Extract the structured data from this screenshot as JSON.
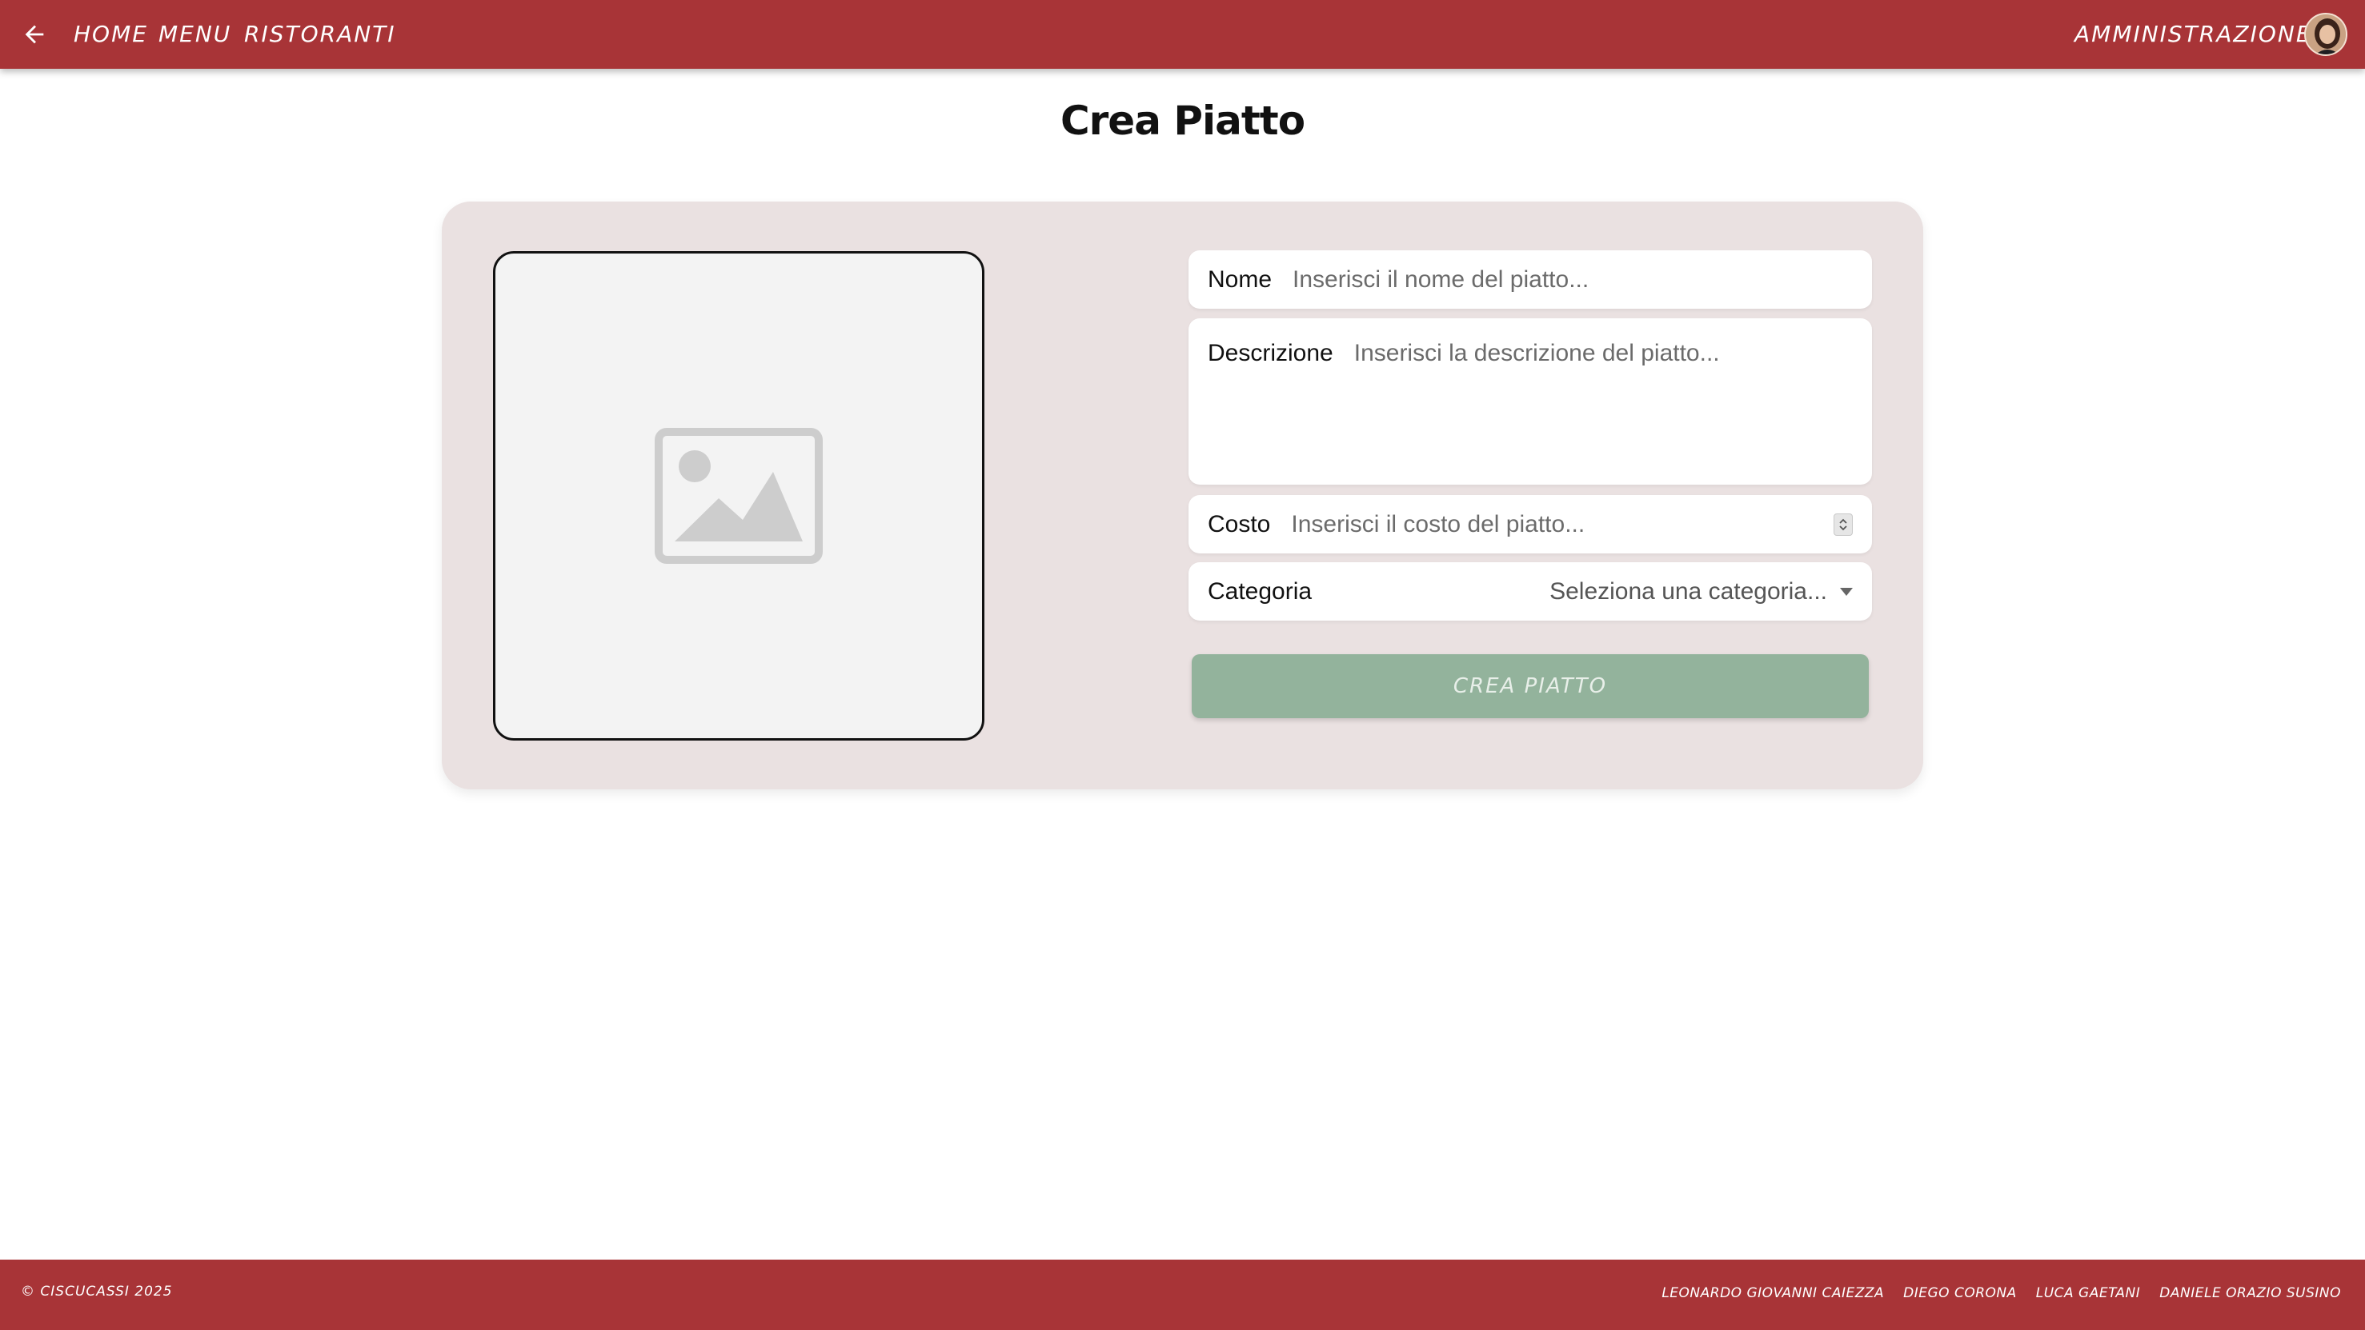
{
  "header": {
    "back_icon": "arrow-left-icon",
    "nav": [
      {
        "label": "HOME"
      },
      {
        "label": "MENU"
      },
      {
        "label": "RISTORANTI"
      }
    ],
    "admin_label": "AMMINISTRAZIONE",
    "avatar_icon": "avatar"
  },
  "page": {
    "title": "Crea Piatto"
  },
  "form": {
    "image_placeholder_icon": "image-placeholder-icon",
    "nome": {
      "label": "Nome",
      "placeholder": "Inserisci il nome del piatto..."
    },
    "descrizione": {
      "label": "Descrizione",
      "placeholder": "Inserisci la descrizione del piatto..."
    },
    "costo": {
      "label": "Costo",
      "placeholder": "Inserisci il costo del piatto..."
    },
    "categoria": {
      "label": "Categoria",
      "selected": "Seleziona una categoria..."
    },
    "submit_label": "CREA PIATTO"
  },
  "footer": {
    "copyright": "© CISCUCASSI 2025",
    "authors": [
      "LEONARDO GIOVANNI CAIEZZA",
      "DIEGO CORONA",
      "LUCA GAETANI",
      "DANIELE ORAZIO SUSINO"
    ]
  },
  "colors": {
    "primary": "#a83437",
    "card": "#eae1e1",
    "button": "#93b39c"
  }
}
